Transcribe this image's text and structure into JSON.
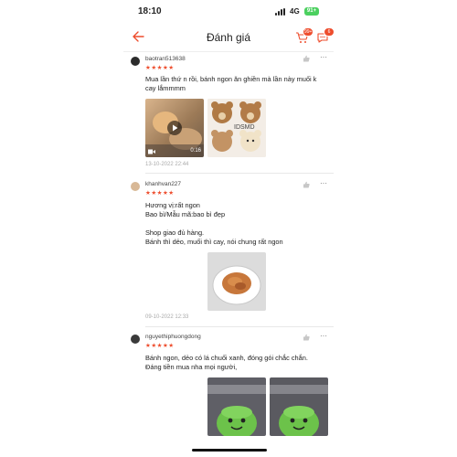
{
  "status_bar": {
    "time": "18:10",
    "network": "4G",
    "battery": "91+"
  },
  "header": {
    "title": "Đánh giá",
    "cart_badge": "99+",
    "chat_badge": "6"
  },
  "reviews": [
    {
      "username": "baotran513638",
      "stars": "★★★★★",
      "text": "Mua lần thứ n rồi, bánh ngon ăn ghiền mà lần này muối k\ncay lắmmmm",
      "video_duration": "0:16",
      "media_watermark": "IDSMD",
      "date": "13-10-2022 22:44"
    },
    {
      "username": "khanhvan227",
      "stars": "★★★★★",
      "text": "Hương vị:rất ngon\nBao bì/Mẫu mã:bao bì đẹp\n\nShop giao đủ hàng.\nBánh thì dẻo, muối thì cay, nói chung rất ngon",
      "date": "09-10-2022 12:33"
    },
    {
      "username": "nguyethiphuongdong",
      "stars": "★★★★★",
      "text": "Bánh ngon, dẻo có lá chuối xanh, đóng gói chắc chắn.\nĐáng tiền mua nha mọi người,"
    }
  ],
  "colors": {
    "accent": "#ee4d2d",
    "star": "#ee4d2d",
    "muted": "#aaaaaa"
  }
}
